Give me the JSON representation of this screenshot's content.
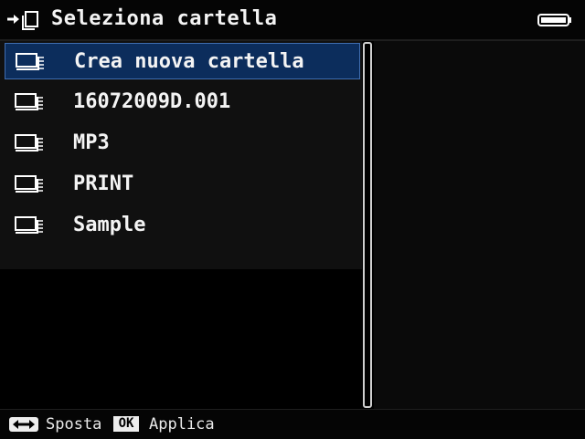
{
  "header": {
    "title": "Seleziona cartella",
    "icon": "move-to-folder-icon",
    "battery_icon": "battery-icon"
  },
  "folders": [
    {
      "label": "Crea nuova cartella",
      "selected": true,
      "icon": "folder-icon"
    },
    {
      "label": "16072009D.001",
      "selected": false,
      "icon": "folder-icon"
    },
    {
      "label": "MP3",
      "selected": false,
      "icon": "folder-icon"
    },
    {
      "label": "PRINT",
      "selected": false,
      "icon": "folder-icon"
    },
    {
      "label": "Sample",
      "selected": false,
      "icon": "folder-icon"
    }
  ],
  "footer": {
    "move_icon": "dpad-left-right-icon",
    "move_label": "Sposta",
    "ok_key": "OK",
    "apply_label": "Applica"
  },
  "colors": {
    "background": "#000000",
    "list_background": "#101010",
    "selection_fill": "#0c2d5c",
    "selection_border": "#3f6db0",
    "text": "#f4f4f4"
  }
}
